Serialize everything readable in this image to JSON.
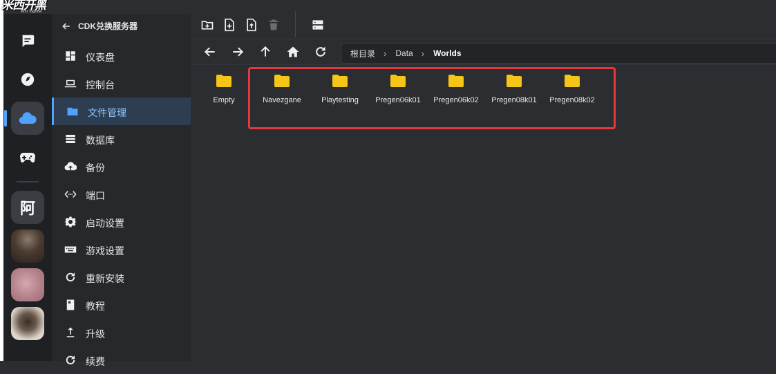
{
  "brand": {
    "title": "米西开黑",
    "subtitle": "MIXI Together"
  },
  "sidebar": {
    "back_label": "CDK兑换服务器",
    "items": [
      {
        "label": "仪表盘",
        "icon": "dashboard-icon"
      },
      {
        "label": "控制台",
        "icon": "laptop-icon"
      },
      {
        "label": "文件管理",
        "icon": "folder-icon",
        "active": true
      },
      {
        "label": "数据库",
        "icon": "database-icon"
      },
      {
        "label": "备份",
        "icon": "cloud-upload-icon"
      },
      {
        "label": "端口",
        "icon": "port-icon"
      },
      {
        "label": "启动设置",
        "icon": "gear-icon"
      },
      {
        "label": "游戏设置",
        "icon": "keyboard-icon"
      },
      {
        "label": "重新安装",
        "icon": "refresh-icon"
      },
      {
        "label": "教程",
        "icon": "book-icon"
      },
      {
        "label": "升级",
        "icon": "upload-icon"
      },
      {
        "label": "续费",
        "icon": "renew-icon"
      }
    ]
  },
  "rail": {
    "avatar_letter": "阿"
  },
  "breadcrumb": {
    "items": [
      "根目录",
      "Data",
      "Worlds"
    ]
  },
  "files": [
    {
      "name": "Empty"
    },
    {
      "name": "Navezgane"
    },
    {
      "name": "Playtesting"
    },
    {
      "name": "Pregen06k01"
    },
    {
      "name": "Pregen06k02"
    },
    {
      "name": "Pregen08k01"
    },
    {
      "name": "Pregen08k02"
    }
  ],
  "colors": {
    "accent": "#4fa3ff",
    "folder": "#f5c518",
    "highlight": "#e5393e"
  }
}
